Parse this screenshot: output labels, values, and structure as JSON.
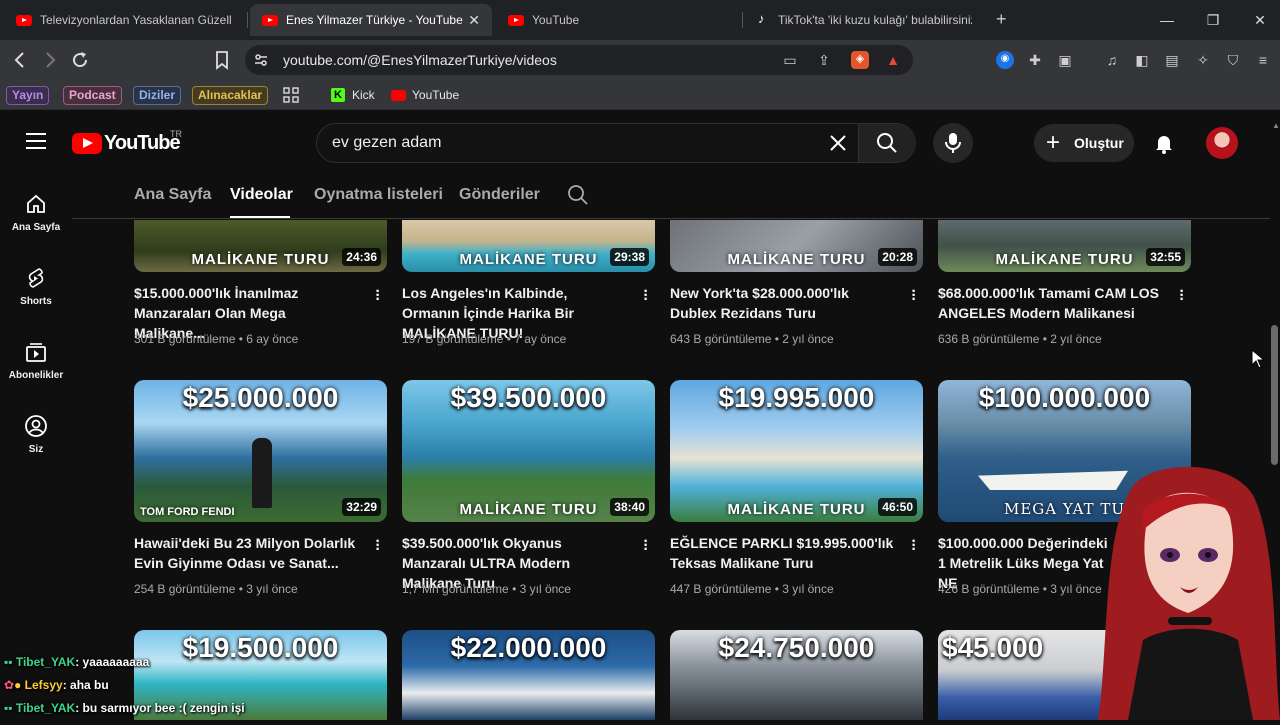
{
  "browser": {
    "tabs": [
      {
        "label": "Televizyonlardan Yasaklanan Güzellik"
      },
      {
        "label": "Enes Yilmazer Türkiye - YouTube"
      },
      {
        "label": "YouTube"
      },
      {
        "label": "TikTok'ta 'iki kuzu kulağı' bulabilirsiniz"
      }
    ],
    "new_tab": "+",
    "url": "youtube.com/@EnesYilmazerTurkiye/videos",
    "bookmarks": [
      "Yayın",
      "Podcast",
      "Diziler",
      "Alınacaklar",
      "Kick",
      "YouTube"
    ],
    "bookmark_colors": {
      "Yayın": "#b48cf0",
      "Podcast": "#f0a0d0",
      "Diziler": "#8fb4f5",
      "Alınacaklar": "#e6c04a"
    }
  },
  "youtube": {
    "logo": "YouTube",
    "country": "TR",
    "search_value": "ev gezen adam",
    "create_label": "Oluştur",
    "rail": [
      {
        "label": "Ana Sayfa",
        "icon": "home-icon"
      },
      {
        "label": "Shorts",
        "icon": "shorts-icon"
      },
      {
        "label": "Abonelikler",
        "icon": "subscriptions-icon"
      },
      {
        "label": "Siz",
        "icon": "you-icon"
      }
    ],
    "channel_tabs": [
      "Ana Sayfa",
      "Videolar",
      "Oynatma listeleri",
      "Gönderiler"
    ],
    "selected_tab": "Videolar",
    "videos_row1": [
      {
        "title": "$15.000.000'lık İnanılmaz Manzaraları Olan Mega Malikane...",
        "meta": "301 B görüntüleme • 6 ay önce",
        "duration": "24:36",
        "tag": "MALİKANE TURU"
      },
      {
        "title": "Los Angeles'ın Kalbinde, Ormanın İçinde Harika Bir MALİKANE TURU!",
        "meta": "197 B görüntüleme • 7 ay önce",
        "duration": "29:38",
        "tag": "MALİKANE TURU"
      },
      {
        "title": "New York'ta $28.000.000'lık Dublex Rezidans Turu",
        "meta": "643 B görüntüleme • 2 yıl önce",
        "duration": "20:28",
        "tag": "MALİKANE TURU"
      },
      {
        "title": "$68.000.000'lık Tamami CAM LOS ANGELES Modern Malikanesi",
        "meta": "636 B görüntüleme • 2 yıl önce",
        "duration": "32:55",
        "tag": "MALİKANE TURU"
      }
    ],
    "videos_row2": [
      {
        "title": "Hawaii'deki Bu 23 Milyon Dolarlık Evin Giyinme Odası ve Sanat...",
        "meta": "254 B görüntüleme • 3 yıl önce",
        "duration": "32:29",
        "price": "$25.000.000",
        "tag": "TOM FORD  FENDI"
      },
      {
        "title": "$39.500.000'lık Okyanus Manzaralı ULTRA Modern Malikane Turu",
        "meta": "1,7 Mn görüntüleme • 3 yıl önce",
        "duration": "38:40",
        "price": "$39.500.000",
        "tag": "MALİKANE TURU"
      },
      {
        "title": "EĞLENCE PARKLI $19.995.000'lık Teksas Malikane Turu",
        "meta": "447 B görüntüleme • 3 yıl önce",
        "duration": "46:50",
        "price": "$19.995.000",
        "tag": "MALİKANE TURU"
      },
      {
        "title": "$100.000.000 Değerindeki 1 Metrelik Lüks Mega Yat NE",
        "meta": "426 B görüntüleme • 3 yıl önce",
        "duration": "",
        "price": "$100.000.000",
        "tag": "MEGA YAT TU"
      }
    ],
    "videos_row3": [
      {
        "price": "$19.500.000"
      },
      {
        "price": "$22.000.000"
      },
      {
        "price": "$24.750.000"
      },
      {
        "price": "$45.000"
      }
    ]
  },
  "chat": [
    {
      "user": "Tibet_YAK",
      "msg": ": yaaaaaaaaa"
    },
    {
      "user": "Lefsyy",
      "msg": ": aha bu"
    },
    {
      "user": "Tibet_YAK",
      "msg": ": bu sarmıyor bee :( zengin işi"
    }
  ]
}
